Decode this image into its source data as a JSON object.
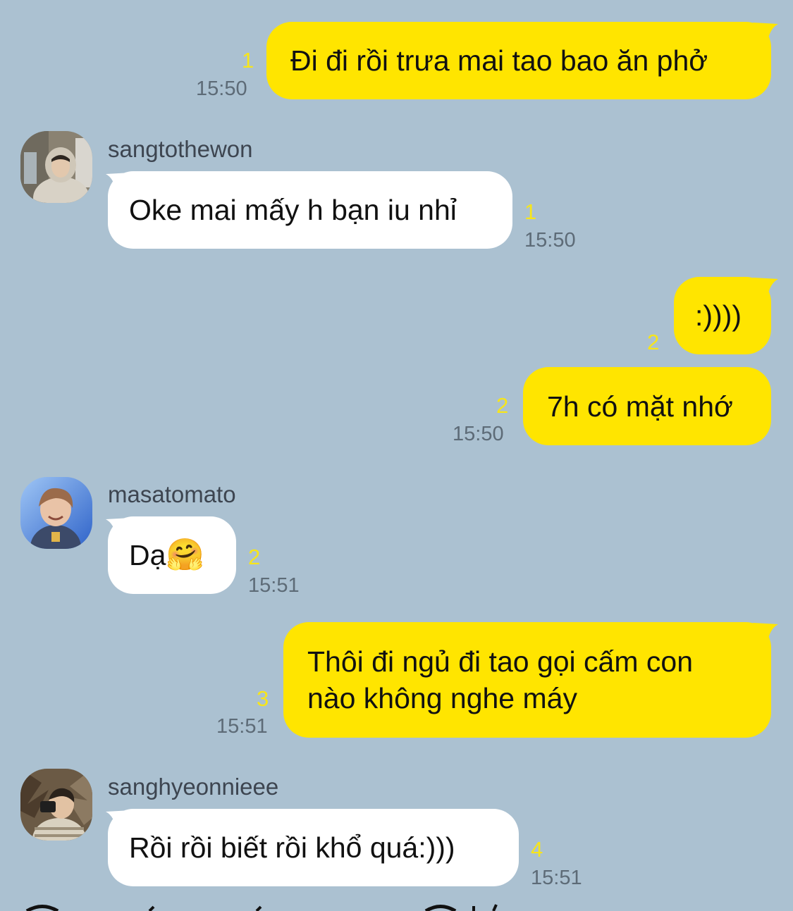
{
  "messages": [
    {
      "id": "m1",
      "side": "mine",
      "text": "Đi đi rồi trưa mai tao bao ăn phở",
      "unread": "1",
      "time": "15:50"
    },
    {
      "id": "m2",
      "side": "theirs",
      "sender": "sangtothewon",
      "avatar_icon": "profile-photo-hooded-person",
      "text": "Oke mai mấy h bạn iu nhỉ",
      "unread": "1",
      "time": "15:50"
    },
    {
      "id": "m3",
      "side": "mine",
      "text": ":))))",
      "unread": "2",
      "time": ""
    },
    {
      "id": "m4",
      "side": "mine",
      "text": "7h có mặt nhớ",
      "unread": "2",
      "time": "15:50"
    },
    {
      "id": "m5",
      "side": "theirs",
      "sender": "masatomato",
      "avatar_icon": "profile-photo-smiling-person",
      "text": "Dạ",
      "emoji": "🤗",
      "unread": "2",
      "time": "15:51"
    },
    {
      "id": "m6",
      "side": "mine",
      "text_lines": [
        "Thôi đi ngủ đi tao gọi cấm con",
        "nào không nghe máy"
      ],
      "unread": "3",
      "time": "15:51"
    },
    {
      "id": "m7",
      "side": "theirs",
      "sender": "sanghyeonnieee",
      "avatar_icon": "profile-photo-person-with-camera",
      "text": "Rồi rồi biết rồi khổ quá:)))",
      "unread": "4",
      "time": "15:51"
    }
  ],
  "colors": {
    "background": "#abc1d1",
    "my_bubble": "#ffe500",
    "their_bubble": "#ffffff",
    "unread_count": "#f7e51a"
  }
}
